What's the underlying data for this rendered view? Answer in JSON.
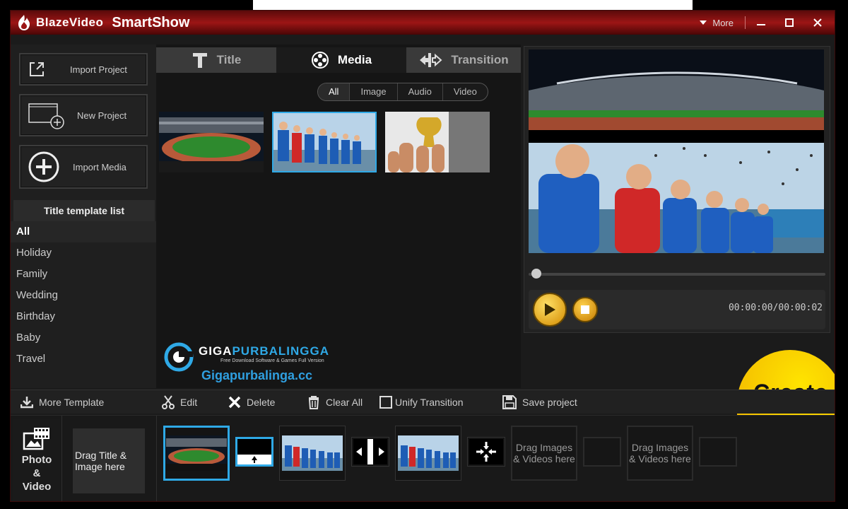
{
  "window": {
    "brand": "BlazeVideo",
    "product": "SmartShow",
    "more_label": "More"
  },
  "left_panel": {
    "buttons": [
      {
        "label": "Import  Project",
        "icon": "export-icon"
      },
      {
        "label": "New Project",
        "icon": "new-project-icon"
      },
      {
        "label": "Import Media",
        "icon": "add-circle-icon"
      }
    ],
    "template_header": "Title template list",
    "templates": [
      "All",
      "Holiday",
      "Family",
      "Wedding",
      "Birthday",
      "Baby",
      "Travel"
    ],
    "selected_template": "All"
  },
  "tabs": [
    {
      "label": "Title",
      "icon": "title-t-icon"
    },
    {
      "label": "Media",
      "icon": "film-reel-icon"
    },
    {
      "label": "Transition",
      "icon": "transition-arrows-icon"
    }
  ],
  "active_tab": "Media",
  "filters": [
    "All",
    "Image",
    "Audio",
    "Video"
  ],
  "active_filter": "All",
  "media_items": [
    "stadium",
    "team-lineup",
    "trophy"
  ],
  "watermark": {
    "name_part1": "GIGA",
    "name_part2": "PURBALINGGA",
    "tagline": "Free Download Software & Games Full Version",
    "url": "Gigapurbalinga.cc"
  },
  "preview": {
    "time": "00:00:00/00:00:02",
    "progress": 0
  },
  "create_label": "Create",
  "toolbar": {
    "more_template": "More Template",
    "edit": "Edit",
    "delete": "Delete",
    "clear_all": "Clear All",
    "unify_transition": "Unify Transition",
    "save_project": "Save project"
  },
  "storyboard": {
    "photo_video_label_1": "Photo",
    "photo_video_label_2": "&",
    "photo_video_label_3": "Video",
    "drag_title": "Drag Title & Image here",
    "drag_media": "Drag Images & Videos here",
    "drag_media_2": "Drag Images & Videos here"
  },
  "colors": {
    "accent": "#2fa9e6",
    "create": "#ffd000",
    "titlebar": "#9c1515"
  }
}
